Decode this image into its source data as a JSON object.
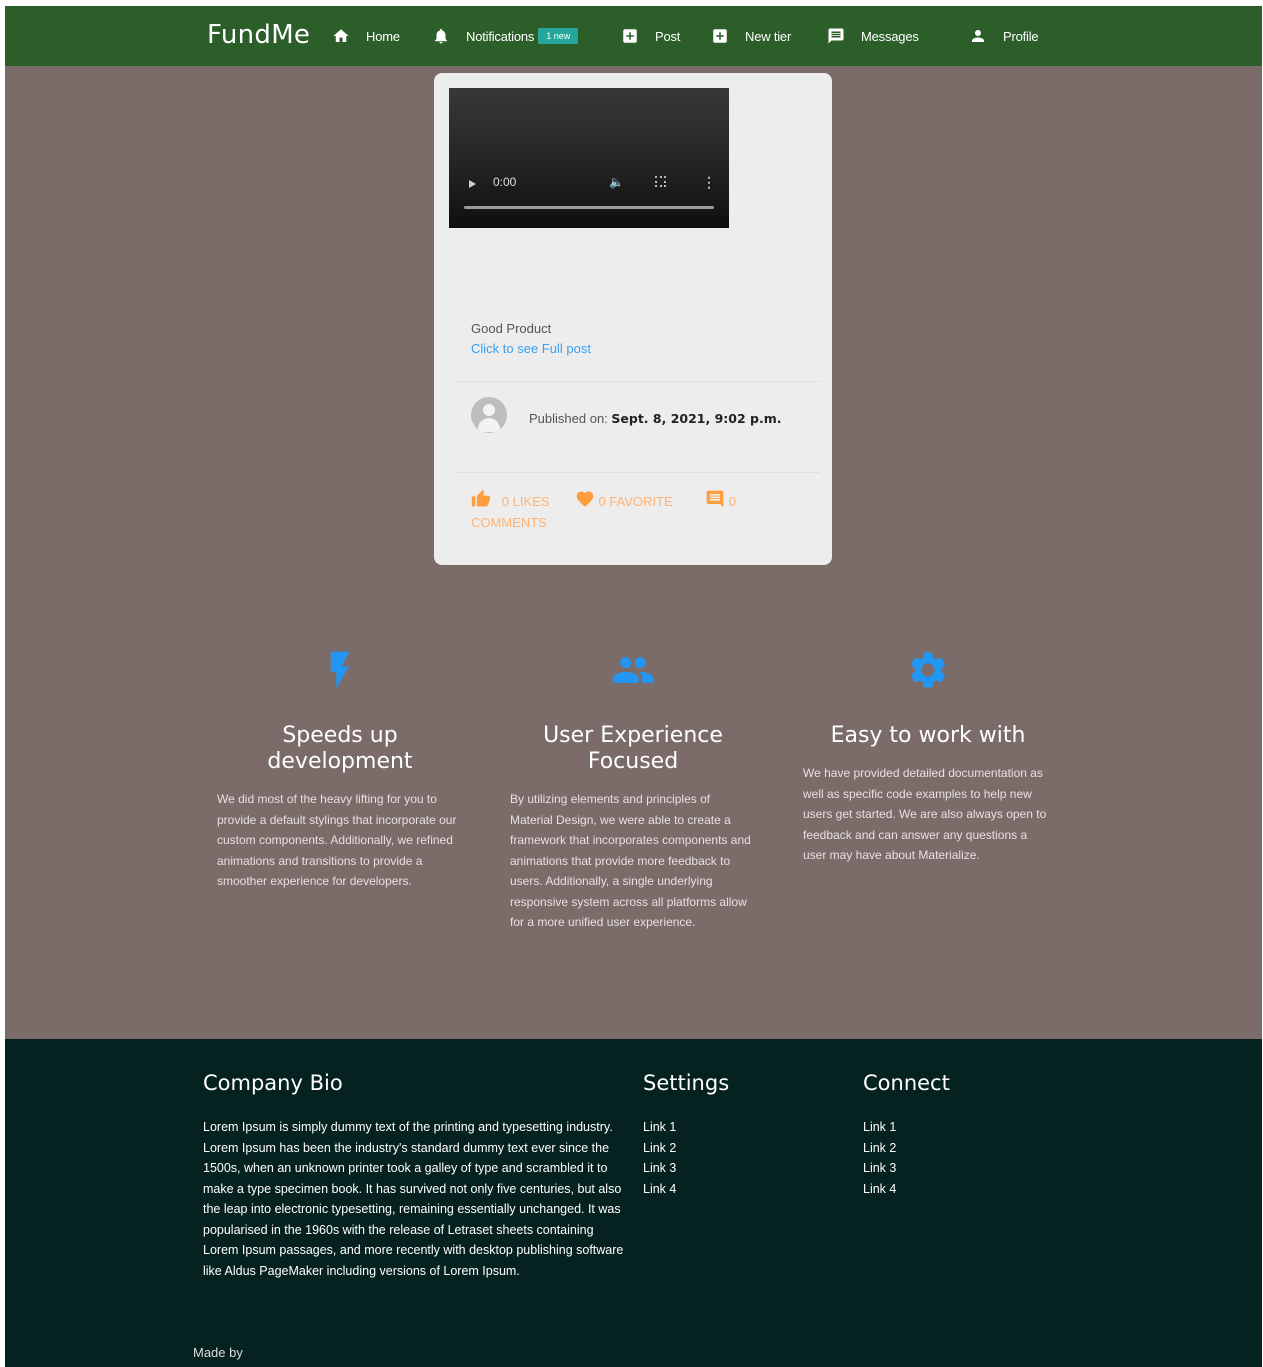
{
  "nav": {
    "brand": "FundMe",
    "items": [
      {
        "label": "Home",
        "icon": "home-icon"
      },
      {
        "label": "Notifications",
        "icon": "bell-icon",
        "badge": "1 new"
      },
      {
        "label": "Post",
        "icon": "add-box-icon"
      },
      {
        "label": "New tier",
        "icon": "add-box-icon"
      },
      {
        "label": "Messages",
        "icon": "message-icon"
      },
      {
        "label": "Profile",
        "icon": "person-icon"
      }
    ]
  },
  "card": {
    "video": {
      "time": "0:00"
    },
    "title": "Good Product",
    "link": "Click to see Full post",
    "published_prefix": "Published on:",
    "published_date": "Sept. 8, 2021, 9:02 p.m.",
    "likes": "0 LIKES",
    "favorites": "0 FAVORITE",
    "comments_count": "0",
    "comments_label": "COMMENTS"
  },
  "features": [
    {
      "icon": "flash-icon",
      "title": "Speeds up development",
      "text": "We did most of the heavy lifting for you to provide a default stylings that incorporate our custom components. Additionally, we refined animations and transitions to provide a smoother experience for developers."
    },
    {
      "icon": "group-icon",
      "title": "User Experience Focused",
      "text": "By utilizing elements and principles of Material Design, we were able to create a framework that incorporates components and animations that provide more feedback to users. Additionally, a single underlying responsive system across all platforms allow for a more unified user experience."
    },
    {
      "icon": "settings-icon",
      "title": "Easy to work with",
      "text": "We have provided detailed documentation as well as specific code examples to help new users get started. We are also always open to feedback and can answer any questions a user may have about Materialize."
    }
  ],
  "footer": {
    "bio_title": "Company Bio",
    "bio_text": "Lorem Ipsum is simply dummy text of the printing and typesetting industry. Lorem Ipsum has been the industry's standard dummy text ever since the 1500s, when an unknown printer took a galley of type and scrambled it to make a type specimen book. It has survived not only five centuries, but also the leap into electronic typesetting, remaining essentially unchanged. It was popularised in the 1960s with the release of Letraset sheets containing Lorem Ipsum passages, and more recently with desktop publishing software like Aldus PageMaker including versions of Lorem Ipsum.",
    "settings_title": "Settings",
    "settings_links": [
      "Link 1",
      "Link 2",
      "Link 3",
      "Link 4"
    ],
    "connect_title": "Connect",
    "connect_links": [
      "Link 1",
      "Link 2",
      "Link 3",
      "Link 4"
    ],
    "made_by": "Made by"
  },
  "colors": {
    "nav_bg": "#2c5e2a",
    "page_bg": "#7b6c6a",
    "footer_bg": "#052220",
    "accent_blue": "#2196f3",
    "action_orange": "#ff9d3f",
    "badge_teal": "#26a69a"
  }
}
